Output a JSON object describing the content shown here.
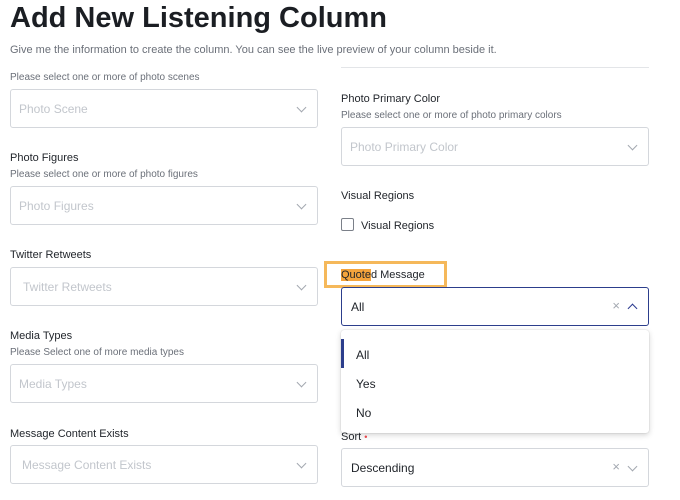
{
  "header": {
    "title": "Add New Listening Column",
    "subtitle": "Give me the information to create the column. You can see the live preview of your column beside it."
  },
  "left": {
    "photo_scene": {
      "hint": "Please select one or more of photo scenes",
      "placeholder": "Photo Scene"
    },
    "photo_figures": {
      "label": "Photo Figures",
      "hint": "Please select one or more of photo figures",
      "placeholder": "Photo Figures"
    },
    "twitter_retweets": {
      "label": "Twitter Retweets",
      "placeholder": "Twitter Retweets"
    },
    "media_types": {
      "label": "Media Types",
      "hint": "Please Select one of more media types",
      "placeholder": "Media Types"
    },
    "message_content_exists": {
      "label": "Message Content Exists",
      "placeholder": "Message Content Exists"
    }
  },
  "right": {
    "photo_primary_color": {
      "label": "Photo Primary Color",
      "hint": "Please select one or more of photo primary colors",
      "placeholder": "Photo Primary Color"
    },
    "visual_regions": {
      "label": "Visual Regions",
      "checkbox_label": "Visual Regions",
      "checked": false
    },
    "quoted_message": {
      "label_highlight": "Quote",
      "label_rest": "d Message",
      "value": "All",
      "clear_glyph": "×",
      "options": [
        "All",
        "Yes",
        "No"
      ],
      "selected_index": 0
    },
    "sort": {
      "label": "Sort",
      "required_mark": "•",
      "value": "Descending",
      "clear_glyph": "×"
    }
  },
  "colors": {
    "accent": "#2c3e8c",
    "highlight_border": "#f5b85a",
    "highlight_fill": "#f4a43c",
    "required": "#e5484d"
  }
}
